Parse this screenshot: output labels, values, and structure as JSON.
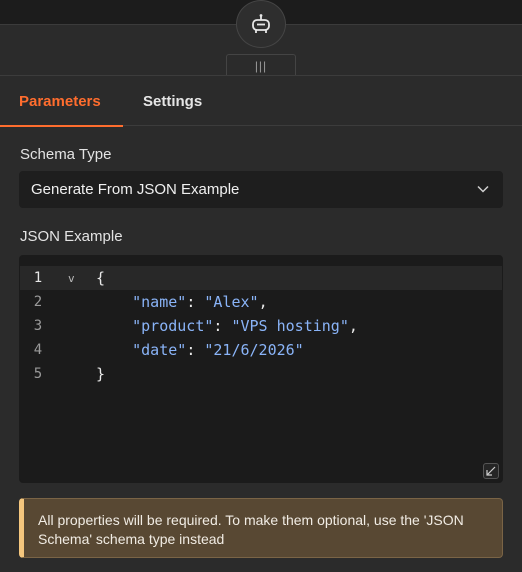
{
  "header": {
    "node_icon": "robot-icon",
    "drag_handle": "|||"
  },
  "tabs": [
    {
      "label": "Parameters",
      "active": true
    },
    {
      "label": "Settings",
      "active": false
    }
  ],
  "schema_type": {
    "label": "Schema Type",
    "selected": "Generate From JSON Example",
    "icon": "chevron-down-icon"
  },
  "json_example": {
    "label": "JSON Example",
    "line_numbers": [
      "1",
      "2",
      "3",
      "4",
      "5"
    ],
    "lines": [
      [
        {
          "t": "{",
          "c": "p"
        }
      ],
      [
        {
          "t": "    ",
          "c": "p"
        },
        {
          "t": "\"name\"",
          "c": "key"
        },
        {
          "t": ": ",
          "c": "p"
        },
        {
          "t": "\"Alex\"",
          "c": "str"
        },
        {
          "t": ",",
          "c": "p"
        }
      ],
      [
        {
          "t": "    ",
          "c": "p"
        },
        {
          "t": "\"product\"",
          "c": "key"
        },
        {
          "t": ": ",
          "c": "p"
        },
        {
          "t": "\"VPS hosting\"",
          "c": "str"
        },
        {
          "t": ",",
          "c": "p"
        }
      ],
      [
        {
          "t": "    ",
          "c": "p"
        },
        {
          "t": "\"date\"",
          "c": "key"
        },
        {
          "t": ": ",
          "c": "p"
        },
        {
          "t": "\"21/6/2026\"",
          "c": "str"
        }
      ],
      [
        {
          "t": "}",
          "c": "p"
        }
      ]
    ],
    "fold_marker": "v"
  },
  "notice": {
    "text": "All properties will be required. To make them optional, use the 'JSON Schema' schema type instead",
    "accent": "#f5c77e"
  },
  "colors": {
    "accent": "#ff6d2e",
    "json_token": "#8ab4f8"
  }
}
